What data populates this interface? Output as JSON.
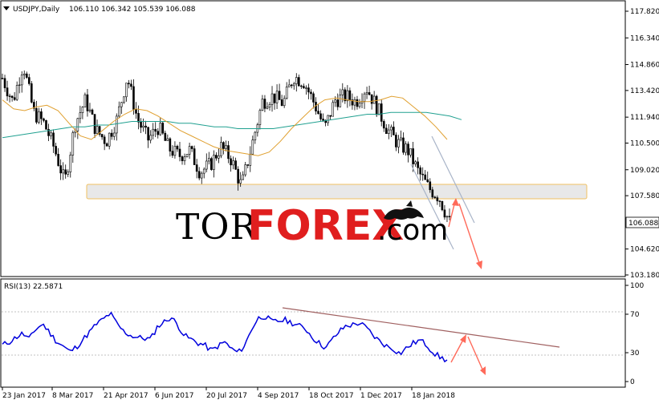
{
  "header": {
    "symbol_timeframe": "USDJPY,Daily",
    "ohlc": "106.110 106.342 105.539 106.088"
  },
  "price_panel": {
    "price_ticks": [
      "117.820",
      "116.340",
      "114.860",
      "113.420",
      "111.940",
      "110.500",
      "109.020",
      "107.580",
      "106.088",
      "104.620",
      "103.180"
    ],
    "current_price": "106.088",
    "support_zone": [
      107.58,
      108.3
    ],
    "colors": {
      "bull": "#000000",
      "bear": "#000000",
      "ma_fast": "#e0a030",
      "ma_slow": "#20a090",
      "zone_fill": "#e8e8e8",
      "zone_border": "#f0c060",
      "arrow": "#ff6a5a",
      "channel": "#a8b4c8"
    }
  },
  "watermark": {
    "part1": "TOR",
    "part2": "FOREX",
    "part3": ".com",
    "logo_icon": "bull-bear-icon"
  },
  "rsi_panel": {
    "label": "RSI(13) 22.5871",
    "ticks": [
      "100",
      "70",
      "30",
      "0"
    ],
    "colors": {
      "rsi": "#0000dd",
      "trendline": "#a06060",
      "arrow": "#ff6a5a"
    }
  },
  "time_axis": {
    "labels": [
      "23 Jan 2017",
      "8 Mar 2017",
      "21 Apr 2017",
      "6 Jun 2017",
      "20 Jul 2017",
      "4 Sep 2017",
      "18 Oct 2017",
      "1 Dec 2017",
      "18 Jan 2018"
    ]
  },
  "chart_data": [
    {
      "type": "candlestick",
      "title": "USDJPY,Daily",
      "ylim": [
        103.18,
        117.82
      ],
      "x": [
        "23 Jan 2017",
        "8 Mar 2017",
        "21 Apr 2017",
        "6 Jun 2017",
        "20 Jul 2017",
        "4 Sep 2017",
        "18 Oct 2017",
        "1 Dec 2017",
        "18 Jan 2018"
      ],
      "close_path": [
        114.1,
        112.8,
        114.9,
        112.2,
        111.6,
        110.2,
        108.3,
        111.6,
        112.9,
        111.2,
        110.6,
        111.8,
        114.2,
        111.8,
        110.7,
        111.4,
        110.2,
        109.8,
        110.1,
        108.9,
        109.3,
        110.3,
        109.6,
        108.1,
        110.4,
        112.8,
        113.1,
        112.7,
        114.2,
        113.9,
        112.7,
        111.3,
        112.9,
        113.1,
        112.8,
        113.6,
        112.5,
        111.3,
        110.5,
        110.1,
        108.9,
        108.0,
        107.5,
        106.1
      ],
      "ma_fast_path": [
        112.9,
        112.4,
        112.3,
        112.5,
        112.6,
        112.3,
        111.6,
        110.9,
        110.7,
        111.2,
        111.7,
        112.1,
        112.4,
        112.3,
        112.0,
        111.6,
        111.2,
        110.9,
        110.6,
        110.3,
        110.1,
        110.0,
        109.9,
        109.8,
        110.0,
        110.6,
        111.3,
        111.9,
        112.5,
        112.9,
        113.0,
        112.9,
        112.8,
        112.8,
        112.9,
        113.1,
        113.0,
        112.5,
        112.0,
        111.4,
        110.7
      ],
      "ma_slow_path": [
        110.8,
        110.9,
        111.0,
        111.1,
        111.2,
        111.3,
        111.4,
        111.4,
        111.5,
        111.5,
        111.6,
        111.7,
        111.7,
        111.7,
        111.7,
        111.6,
        111.6,
        111.5,
        111.4,
        111.4,
        111.3,
        111.3,
        111.3,
        111.3,
        111.4,
        111.5,
        111.6,
        111.7,
        111.8,
        111.9,
        112.0,
        112.1,
        112.1,
        112.2,
        112.2,
        112.2,
        112.2,
        112.1,
        112.0,
        111.8
      ]
    },
    {
      "type": "line",
      "title": "RSI(13) 22.5871",
      "ylim": [
        0,
        100
      ],
      "series": [
        {
          "values": [
            38,
            41,
            46,
            50,
            44,
            55,
            60,
            51,
            42,
            37,
            31,
            36,
            44,
            52,
            60,
            65,
            71,
            60,
            52,
            48,
            46,
            45,
            44,
            57,
            62,
            67,
            59,
            48,
            44,
            40,
            38,
            32,
            37,
            41,
            34,
            30,
            38,
            55,
            66,
            68,
            62,
            63,
            64,
            61,
            58,
            55,
            46,
            40,
            35,
            44,
            52,
            58,
            59,
            61,
            56,
            48,
            42,
            37,
            34,
            29,
            35,
            40,
            43,
            38,
            30,
            25,
            22
          ]
        }
      ]
    }
  ]
}
